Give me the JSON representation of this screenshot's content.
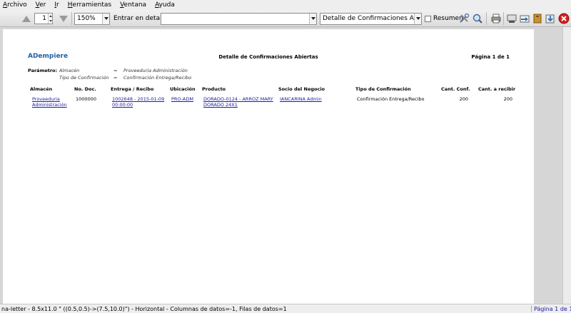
{
  "menu": [
    {
      "key": "archivo",
      "first": "A",
      "rest": "rchivo"
    },
    {
      "key": "ver",
      "first": "V",
      "rest": "er"
    },
    {
      "key": "ir",
      "first": "I",
      "rest": "r"
    },
    {
      "key": "herramientas",
      "first": "H",
      "rest": "erramientas"
    },
    {
      "key": "ventana",
      "first": "V",
      "rest": "entana"
    },
    {
      "key": "ayuda",
      "first": "A",
      "rest": "yuda"
    }
  ],
  "toolbar": {
    "page_value": "1",
    "zoom": "150%",
    "drill_label": "Entrar en detalle:",
    "drill_value": "",
    "report_select": "Detalle de Confirmaciones Abiertas",
    "summary_label": "Resumen",
    "summary_checked": false,
    "icons": [
      "arrow-up-icon",
      "arrow-down-icon",
      "customize-icon",
      "find-icon",
      "print-icon",
      "export-icon",
      "send-icon",
      "archive-icon",
      "download-icon",
      "close-icon"
    ]
  },
  "report": {
    "logo": "ADempiere",
    "title": "Detalle de Confirmaciones Abiertas",
    "page_label": "Página 1 de 1",
    "param_header": "Parámetro:",
    "params": [
      {
        "name": "Almacén",
        "op": "=",
        "value": "Proveeduria Administración"
      },
      {
        "name": "Tipo de Confirmación",
        "op": "=",
        "value": "Confirmación Entrega/Recibo"
      }
    ],
    "columns": [
      "Almacén",
      "No. Doc.",
      "Entrega / Recibo",
      "Ubicación",
      "Producto",
      "Socio del Negocio",
      "Tipo de Confirmación",
      "Cant. Conf.",
      "Cant. a recibir"
    ],
    "rows": [
      {
        "almacen_l1": "Proveeduria",
        "almacen_l2": "Administración",
        "no_doc": "1000000",
        "entrega_l1": "1002648 - 2015-01-09",
        "entrega_l2": "00:00:00",
        "ubicacion": "PRO-ADM",
        "producto_l1": "DORADO-0124 - ARROZ MARY",
        "producto_l2": "DORADO 24X1",
        "socio": "IANCARINA Admin",
        "tipo": "Confirmación Entrega/Recibo",
        "cant_conf": "200",
        "cant_recibir": "200"
      }
    ]
  },
  "status": {
    "message": "na-letter - 8.5x11.0 \" ((0.5,0.5)->(7.5,10.0)\") - Horizontal - Columnas de datos=-1, Filas de datos=1",
    "page": "Página 1 de 1"
  },
  "colors": {
    "link": "#1a1aa6",
    "logo": "#1f5fa5",
    "close": "#d42020"
  }
}
